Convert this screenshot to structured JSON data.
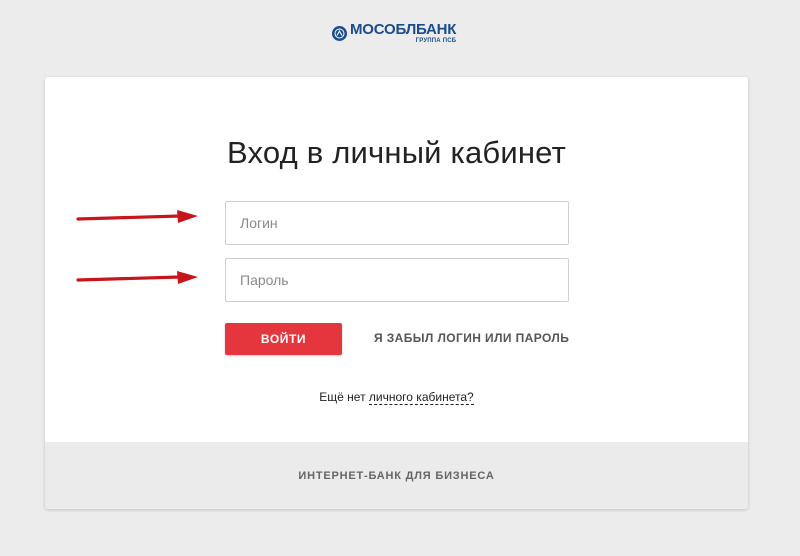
{
  "logo": {
    "name_prefix": "МОСОБЛ",
    "name_suffix": "БАНК",
    "tagline": "ГРУППА ПСБ",
    "icon": "bank-emblem-icon",
    "brand_color": "#1b4c8c"
  },
  "login_form": {
    "title": "Вход в личный кабинет",
    "login_placeholder": "Логин",
    "password_placeholder": "Пароль",
    "submit_label": "ВОЙТИ",
    "forgot_label": "Я ЗАБЫЛ ЛОГИН ИЛИ ПАРОЛЬ",
    "signup_prefix": "Ещё нет ",
    "signup_link": "личного кабинета?",
    "accent_color": "#e5363d"
  },
  "footer": {
    "business_label": "ИНТЕРНЕТ-БАНК ДЛЯ БИЗНЕСА"
  },
  "annotations": {
    "arrow_icon": "red-arrow-icon",
    "arrow_color": "#c8141b"
  }
}
